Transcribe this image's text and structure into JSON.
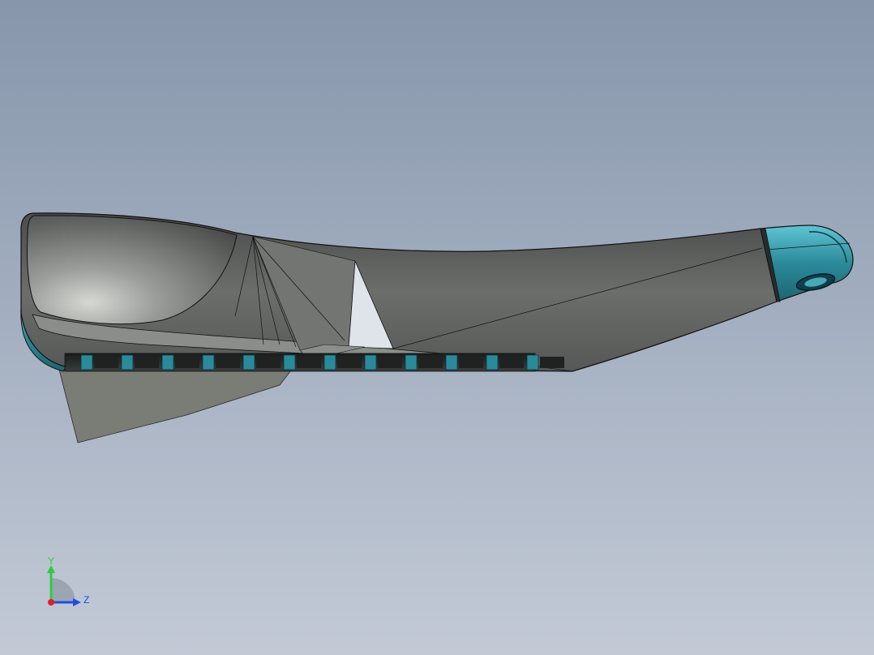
{
  "viewport": {
    "background_top": "#8796ab",
    "background_bottom": "#c3cad6"
  },
  "model": {
    "body_color": "#5f6260",
    "accent_color": "#2b8a9a",
    "edge_color": "#111111"
  },
  "triad": {
    "y_label": "Y",
    "z_label": "Z",
    "y_color": "#2ecc40",
    "z_color": "#1f4fe0",
    "x_color": "#e02020",
    "icon": "coordinate-triad-icon"
  }
}
